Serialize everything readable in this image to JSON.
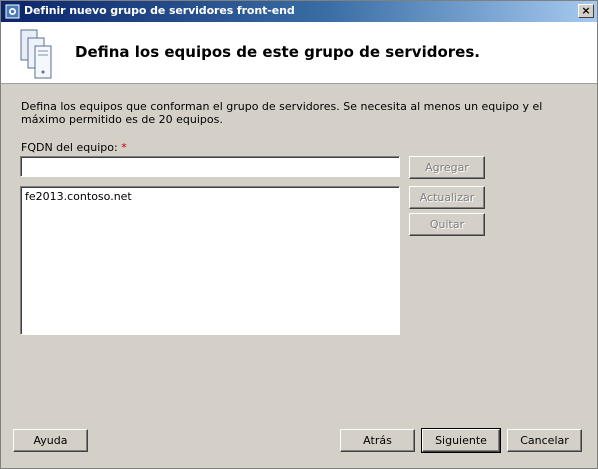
{
  "window": {
    "title": "Definir nuevo grupo de servidores front-end",
    "close_label": "×",
    "title_icon": "app-icon",
    "close_icon": "close-icon"
  },
  "header": {
    "heading": "Defina los equipos de este grupo de servidores.",
    "icon": "server-icon"
  },
  "body": {
    "description": "Defina los equipos que conforman el grupo de servidores. Se necesita al menos un equipo y el máximo permitido es de 20 equipos.",
    "fqdn_label": "FQDN del equipo:",
    "required_mark": "*",
    "fqdn_value": "",
    "computers": [
      "fe2013.contoso.net"
    ]
  },
  "side_buttons": {
    "add": "Agregar",
    "update": "Actualizar",
    "remove": "Quitar"
  },
  "footer": {
    "help": "Ayuda",
    "back": "Atrás",
    "next": "Siguiente",
    "cancel": "Cancelar"
  }
}
